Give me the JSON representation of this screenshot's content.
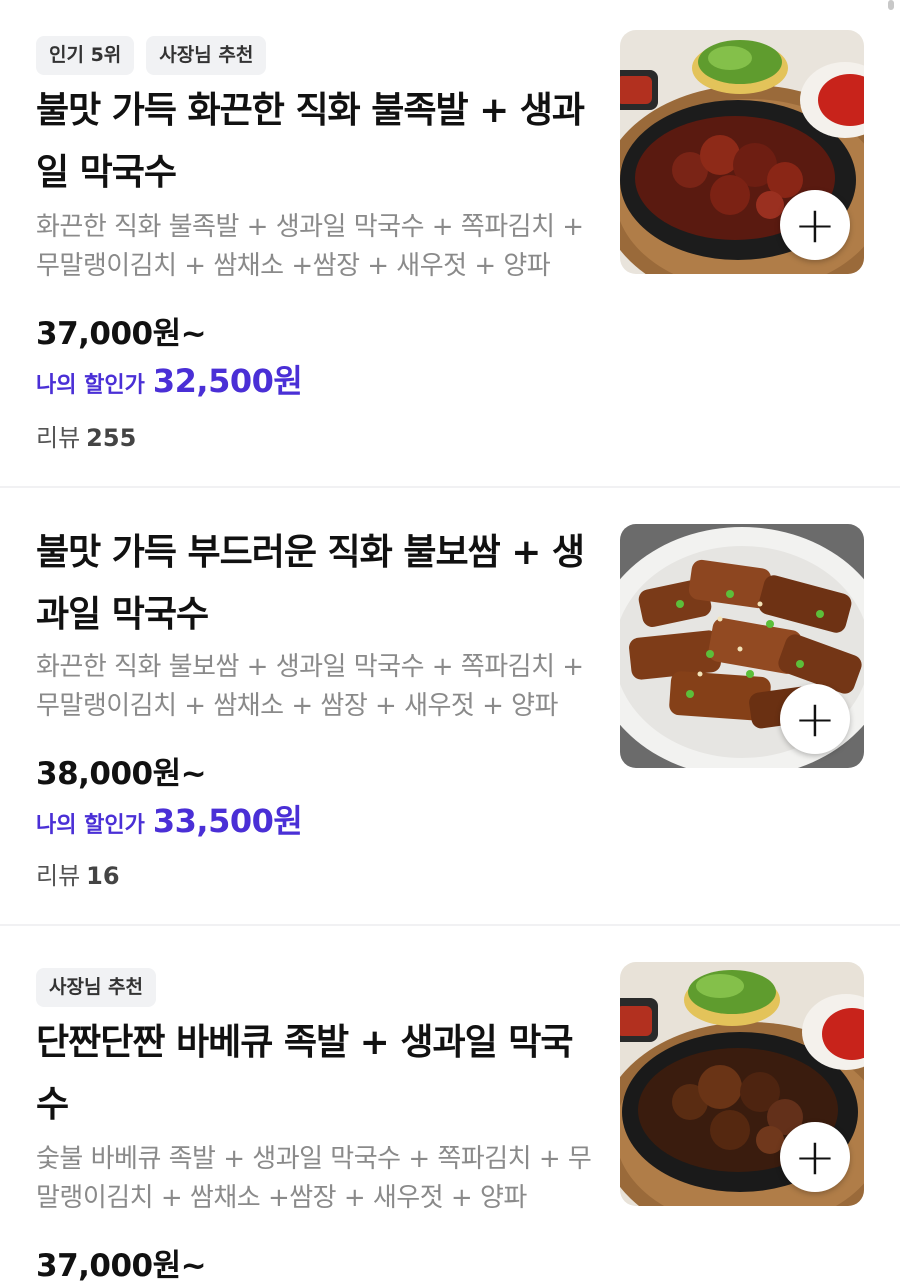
{
  "items": [
    {
      "tags": [
        "인기 5위",
        "사장님 추천"
      ],
      "title": "불맛 가득 화끈한 직화 불족발 + 생과일 막국수",
      "description": "화끈한 직화 불족발 + 생과일 막국수 + 쪽파김치 + 무말랭이김치 + 쌈채소 +쌈장 + 새우젓 + 양파",
      "price": "37,000원~",
      "discount_label": "나의 할인가",
      "discount_price": "32,500원",
      "review_label": "리뷰",
      "review_count": "255",
      "image_icon": "spicy-jokbal-photo",
      "add_icon": "plus-icon"
    },
    {
      "tags": [],
      "title": "불맛 가득 부드러운 직화 불보쌈 + 생과일 막국수",
      "description": "화끈한 직화 불보쌈 + 생과일 막국수 + 쪽파김치 + 무말랭이김치 + 쌈채소 + 쌈장 + 새우젓 + 양파",
      "price": "38,000원~",
      "discount_label": "나의 할인가",
      "discount_price": "33,500원",
      "review_label": "리뷰",
      "review_count": "16",
      "image_icon": "grilled-bossam-photo",
      "add_icon": "plus-icon"
    },
    {
      "tags": [
        "사장님 추천"
      ],
      "title": "단짠단짠 바베큐 족발 + 생과일 막국수",
      "description": "숯불 바베큐 족발 + 생과일 막국수 + 쪽파김치 + 무말랭이김치 + 쌈채소 +쌈장 + 새우젓 + 양파",
      "price": "37,000원~",
      "image_icon": "bbq-jokbal-photo",
      "add_icon": "plus-icon"
    }
  ],
  "colors": {
    "accent": "#4a2fd6",
    "text": "#111111",
    "muted": "#8a8a8a",
    "tag_bg": "#f1f2f4"
  }
}
